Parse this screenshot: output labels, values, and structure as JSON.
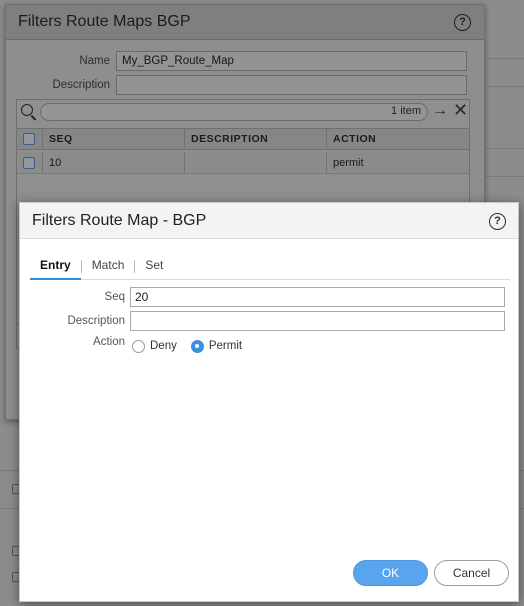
{
  "back_dialog": {
    "title": "Filters Route Maps BGP",
    "name_label": "Name",
    "name_value": "My_BGP_Route_Map",
    "description_label": "Description",
    "description_value": "",
    "search": {
      "item_count": "1 item"
    },
    "table": {
      "columns": [
        "SEQ",
        "DESCRIPTION",
        "ACTION"
      ],
      "rows": [
        {
          "seq": "10",
          "description": "",
          "action": "permit"
        }
      ]
    }
  },
  "front_dialog": {
    "title": "Filters Route Map - BGP",
    "tabs": [
      {
        "label": "Entry",
        "active": true
      },
      {
        "label": "Match",
        "active": false
      },
      {
        "label": "Set",
        "active": false
      }
    ],
    "seq_label": "Seq",
    "seq_value": "20",
    "description_label": "Description",
    "description_value": "",
    "action_label": "Action",
    "action_options": [
      {
        "label": "Deny",
        "selected": false
      },
      {
        "label": "Permit",
        "selected": true
      }
    ],
    "ok_label": "OK",
    "cancel_label": "Cancel"
  },
  "colors": {
    "accent": "#58a4ee",
    "radio_selected": "#3b8ee0",
    "tab_underline": "#2f8cdb",
    "overlay_gray": "#8c8c8c"
  }
}
